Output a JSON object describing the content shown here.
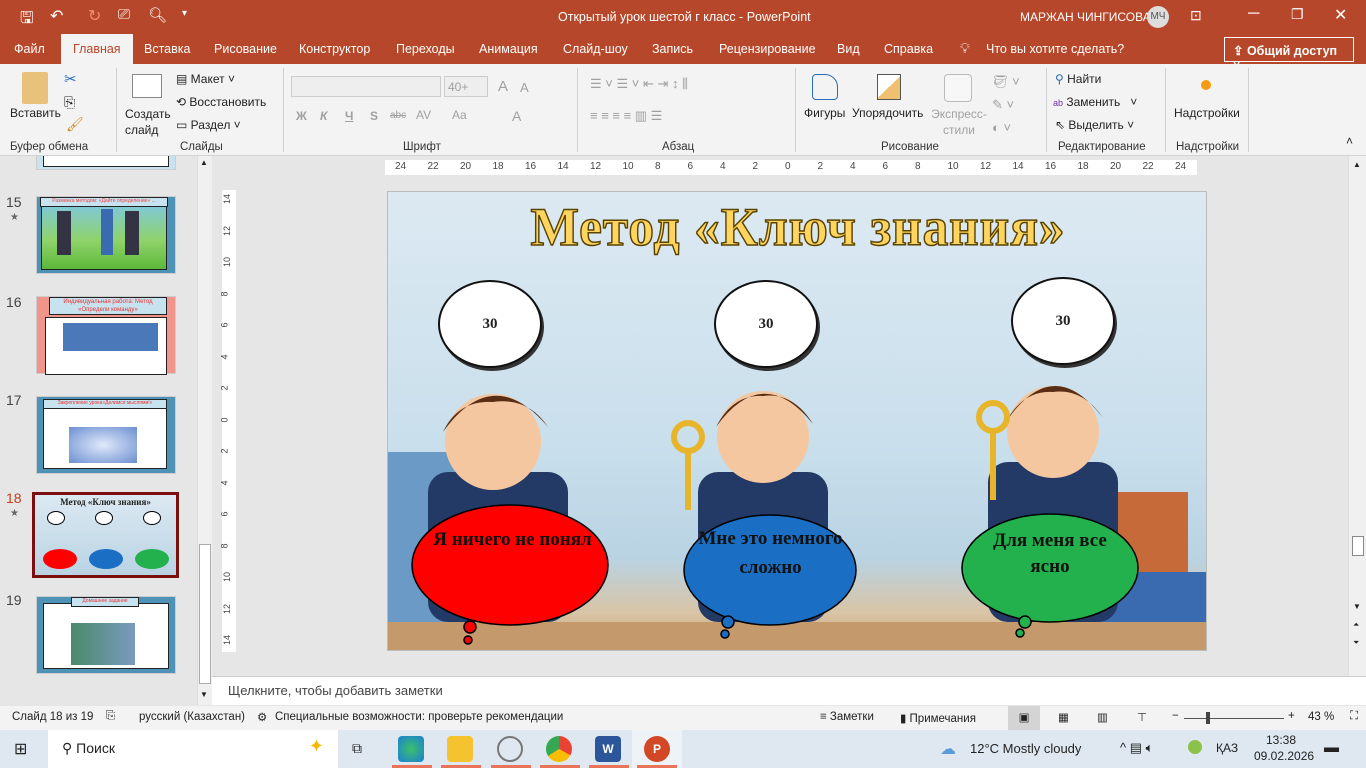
{
  "titlebar": {
    "doc_title": "Открытый урок шестой г класс  -  PowerPoint",
    "user": "МАРЖАН ЧИНГИСОВА",
    "initials": "МЧ"
  },
  "tabs": [
    "Файл",
    "Главная",
    "Вставка",
    "Рисование",
    "Конструктор",
    "Переходы",
    "Анимация",
    "Слайд-шоу",
    "Запись",
    "Рецензирование",
    "Вид",
    "Справка"
  ],
  "tell_me": "Что вы хотите сделать?",
  "share": "Общий доступ",
  "ribbon": {
    "clipboard": {
      "paste": "Вставить",
      "group": "Буфер обмена"
    },
    "slides": {
      "new_slide": "Создать слайд",
      "layout": "Макет",
      "reset": "Восстановить",
      "section": "Раздел",
      "group": "Слайды"
    },
    "font": {
      "size": "40+",
      "group": "Шрифт",
      "bold": "Ж",
      "italic": "К",
      "underline": "Ч",
      "shadow": "S",
      "strike": "abc",
      "spacing": "AV",
      "case": "Aa"
    },
    "paragraph": {
      "group": "Абзац"
    },
    "drawing": {
      "shapes": "Фигуры",
      "arrange": "Упорядочить",
      "styles": "Экспресс-стили",
      "group": "Рисование"
    },
    "editing": {
      "find": "Найти",
      "replace": "Заменить",
      "select": "Выделить",
      "group": "Редактирование"
    },
    "addins": {
      "addins": "Надстройки",
      "group": "Надстройки"
    }
  },
  "ruler": [
    "24",
    "22",
    "20",
    "18",
    "16",
    "14",
    "12",
    "10",
    "8",
    "6",
    "4",
    "2",
    "0",
    "2",
    "4",
    "6",
    "8",
    "10",
    "12",
    "14",
    "16",
    "18",
    "20",
    "22",
    "24"
  ],
  "vruler": [
    "14",
    "12",
    "10",
    "8",
    "6",
    "4",
    "2",
    "0",
    "2",
    "4",
    "6",
    "8",
    "10",
    "12",
    "14"
  ],
  "thumbnails": [
    {
      "num": "15",
      "title": "Разминка методом: «Дайте определение» ...",
      "star": true
    },
    {
      "num": "16",
      "title": "Индивидуальная работа: Метод «Определи команду»",
      "star": false
    },
    {
      "num": "17",
      "title": "Закрепление урока«Делимся мыслями!»",
      "star": false
    },
    {
      "num": "18",
      "title": "Метод «Ключ знания»",
      "star": true,
      "active": true
    },
    {
      "num": "19",
      "title": "Домашнее задание",
      "star": false
    }
  ],
  "slide": {
    "title": "Метод «Ключ знания»",
    "counters": [
      "30",
      "30",
      "30"
    ],
    "clouds": [
      {
        "text": "Я ничего не понял",
        "color": "#ff0000"
      },
      {
        "text": "Мне это немного сложно",
        "color": "#1a6fc4"
      },
      {
        "text": "Для меня все ясно",
        "color": "#22b14c"
      }
    ]
  },
  "notes_placeholder": "Щелкните, чтобы добавить заметки",
  "status": {
    "slide": "Слайд 18 из 19",
    "language": "русский (Казахстан)",
    "accessibility": "Специальные возможности: проверьте рекомендации",
    "notes": "Заметки",
    "comments": "Примечания",
    "zoom": "43 %",
    "zoom_percent": 43
  },
  "taskbar": {
    "search": "Поиск",
    "weather": "12°C  Mostly cloudy",
    "lang": "ҚАЗ",
    "time": "13:38",
    "date": "09.02.2026"
  },
  "colors": {
    "accent": "#b7472a",
    "active_slide_border": "#7b0f10"
  }
}
